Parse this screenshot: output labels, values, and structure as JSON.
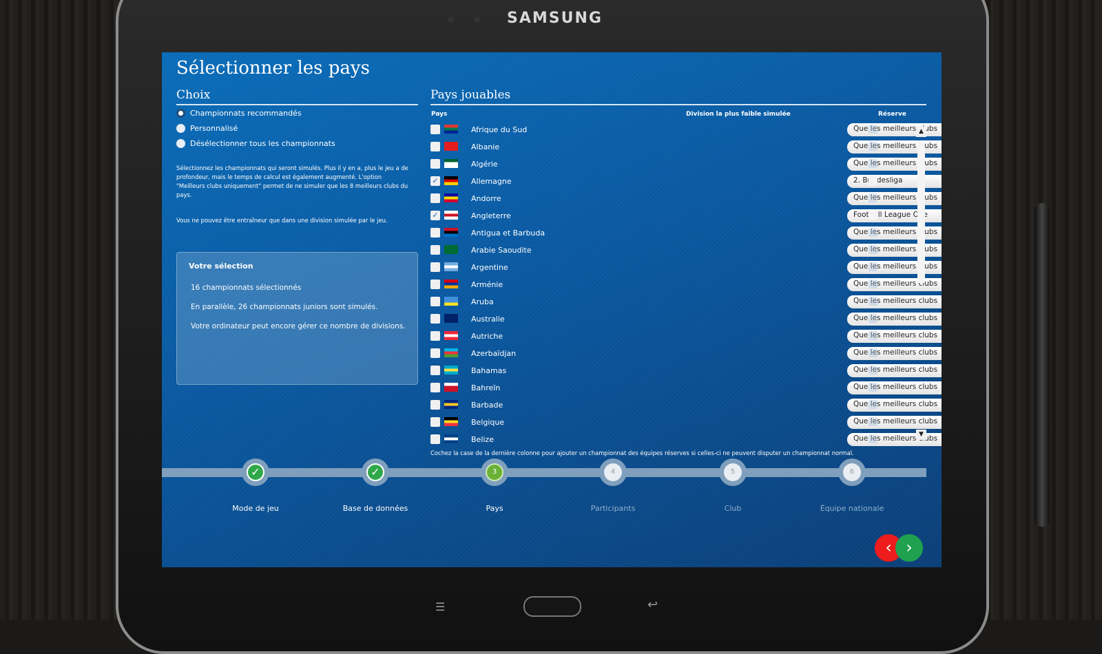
{
  "device": {
    "brand": "SAMSUNG"
  },
  "title": "Sélectionner les pays",
  "choix": {
    "heading": "Choix",
    "options": [
      {
        "label": "Championnats recommandés",
        "selected": true
      },
      {
        "label": "Personnalisé",
        "selected": false
      },
      {
        "label": "Désélectionner tous les championnats",
        "selected": false
      }
    ],
    "help": "Sélectionnez les championnats qui seront simulés. Plus il y en a, plus le jeu a de profondeur, mais le temps de calcul est également augmenté. L'option \"Meilleurs clubs uniquement\" permet de ne simuler que les 8 meilleurs clubs du pays.",
    "note": "Vous ne pouvez être entraîneur que dans une division simulée par le jeu."
  },
  "selection": {
    "title": "Votre sélection",
    "lines": [
      "16 championnats sélectionnés",
      "En parallèle, 26 championnats juniors sont simulés.",
      "Votre ordinateur peut encore gérer ce nombre de divisions."
    ]
  },
  "pays": {
    "heading": "Pays jouables",
    "col_country": "Pays",
    "col_division": "Division la plus faible simulée",
    "col_reserve": "Réserve",
    "rows": [
      {
        "name": "Afrique du Sud",
        "checked": false,
        "division": "Que les meilleurs clubs",
        "reserve": false,
        "flag": [
          "#de3831",
          "#007a4d",
          "#002395"
        ]
      },
      {
        "name": "Albanie",
        "checked": false,
        "division": "Que les meilleurs clubs",
        "reserve": false,
        "flag": [
          "#e41e20",
          "#e41e20",
          "#e41e20"
        ]
      },
      {
        "name": "Algérie",
        "checked": false,
        "division": "Que les meilleurs clubs",
        "reserve": false,
        "flag": [
          "#006233",
          "#ffffff",
          "#ffffff"
        ]
      },
      {
        "name": "Allemagne",
        "checked": true,
        "division": "2. Bundesliga",
        "reserve": true,
        "flag": [
          "#000000",
          "#dd0000",
          "#ffce00"
        ]
      },
      {
        "name": "Andorre",
        "checked": false,
        "division": "Que les meilleurs clubs",
        "reserve": false,
        "flag": [
          "#10069f",
          "#fedd00",
          "#d50032"
        ]
      },
      {
        "name": "Angleterre",
        "checked": true,
        "division": "Football League One",
        "reserve": true,
        "flag": [
          "#ffffff",
          "#ce1124",
          "#ffffff"
        ]
      },
      {
        "name": "Antigua et Barbuda",
        "checked": false,
        "division": "Que les meilleurs clubs",
        "reserve": false,
        "flag": [
          "#ce1126",
          "#000000",
          "#0072c6"
        ]
      },
      {
        "name": "Arabie Saoudite",
        "checked": false,
        "division": "Que les meilleurs clubs",
        "reserve": false,
        "flag": [
          "#006c35",
          "#006c35",
          "#006c35"
        ]
      },
      {
        "name": "Argentine",
        "checked": false,
        "division": "Que les meilleurs clubs",
        "reserve": false,
        "flag": [
          "#74acdf",
          "#ffffff",
          "#74acdf"
        ]
      },
      {
        "name": "Arménie",
        "checked": false,
        "division": "Que les meilleurs clubs",
        "reserve": false,
        "flag": [
          "#d90012",
          "#0033a0",
          "#f2a800"
        ]
      },
      {
        "name": "Aruba",
        "checked": false,
        "division": "Que les meilleurs clubs",
        "reserve": false,
        "flag": [
          "#418fde",
          "#418fde",
          "#fbe122"
        ]
      },
      {
        "name": "Australie",
        "checked": false,
        "division": "Que les meilleurs clubs",
        "reserve": false,
        "flag": [
          "#012169",
          "#012169",
          "#012169"
        ]
      },
      {
        "name": "Autriche",
        "checked": false,
        "division": "Que les meilleurs clubs",
        "reserve": false,
        "flag": [
          "#ed2939",
          "#ffffff",
          "#ed2939"
        ]
      },
      {
        "name": "Azerbaïdjan",
        "checked": false,
        "division": "Que les meilleurs clubs",
        "reserve": false,
        "flag": [
          "#00b5e2",
          "#ef3340",
          "#509e2f"
        ]
      },
      {
        "name": "Bahamas",
        "checked": false,
        "division": "Que les meilleurs clubs",
        "reserve": false,
        "flag": [
          "#00abc9",
          "#fae042",
          "#00abc9"
        ]
      },
      {
        "name": "Bahreïn",
        "checked": false,
        "division": "Que les meilleurs clubs",
        "reserve": false,
        "flag": [
          "#ffffff",
          "#ce1126",
          "#ce1126"
        ]
      },
      {
        "name": "Barbade",
        "checked": false,
        "division": "Que les meilleurs clubs",
        "reserve": false,
        "flag": [
          "#00267f",
          "#ffc726",
          "#00267f"
        ]
      },
      {
        "name": "Belgique",
        "checked": false,
        "division": "Que les meilleurs clubs",
        "reserve": false,
        "flag": [
          "#000000",
          "#fdda24",
          "#ef3340"
        ]
      },
      {
        "name": "Belize",
        "checked": false,
        "division": "Que les meilleurs clubs",
        "reserve": false,
        "flag": [
          "#003f87",
          "#ffffff",
          "#003f87"
        ]
      }
    ],
    "footnote": "Cochez la case de la dernière colonne pour ajouter un championnat des équipes réserves si celles-ci ne peuvent disputer un championnat normal."
  },
  "steps": [
    {
      "num": "1",
      "label": "Mode de jeu",
      "state": "done"
    },
    {
      "num": "2",
      "label": "Base de données",
      "state": "done"
    },
    {
      "num": "3",
      "label": "Pays",
      "state": "current"
    },
    {
      "num": "4",
      "label": "Participants",
      "state": "todo"
    },
    {
      "num": "5",
      "label": "Club",
      "state": "todo"
    },
    {
      "num": "6",
      "label": "Équipe nationale",
      "state": "todo"
    }
  ],
  "colors": {
    "back": "#ee1c1c",
    "next": "#1fa150",
    "done": "#2fa84a",
    "current": "#6ab136"
  }
}
